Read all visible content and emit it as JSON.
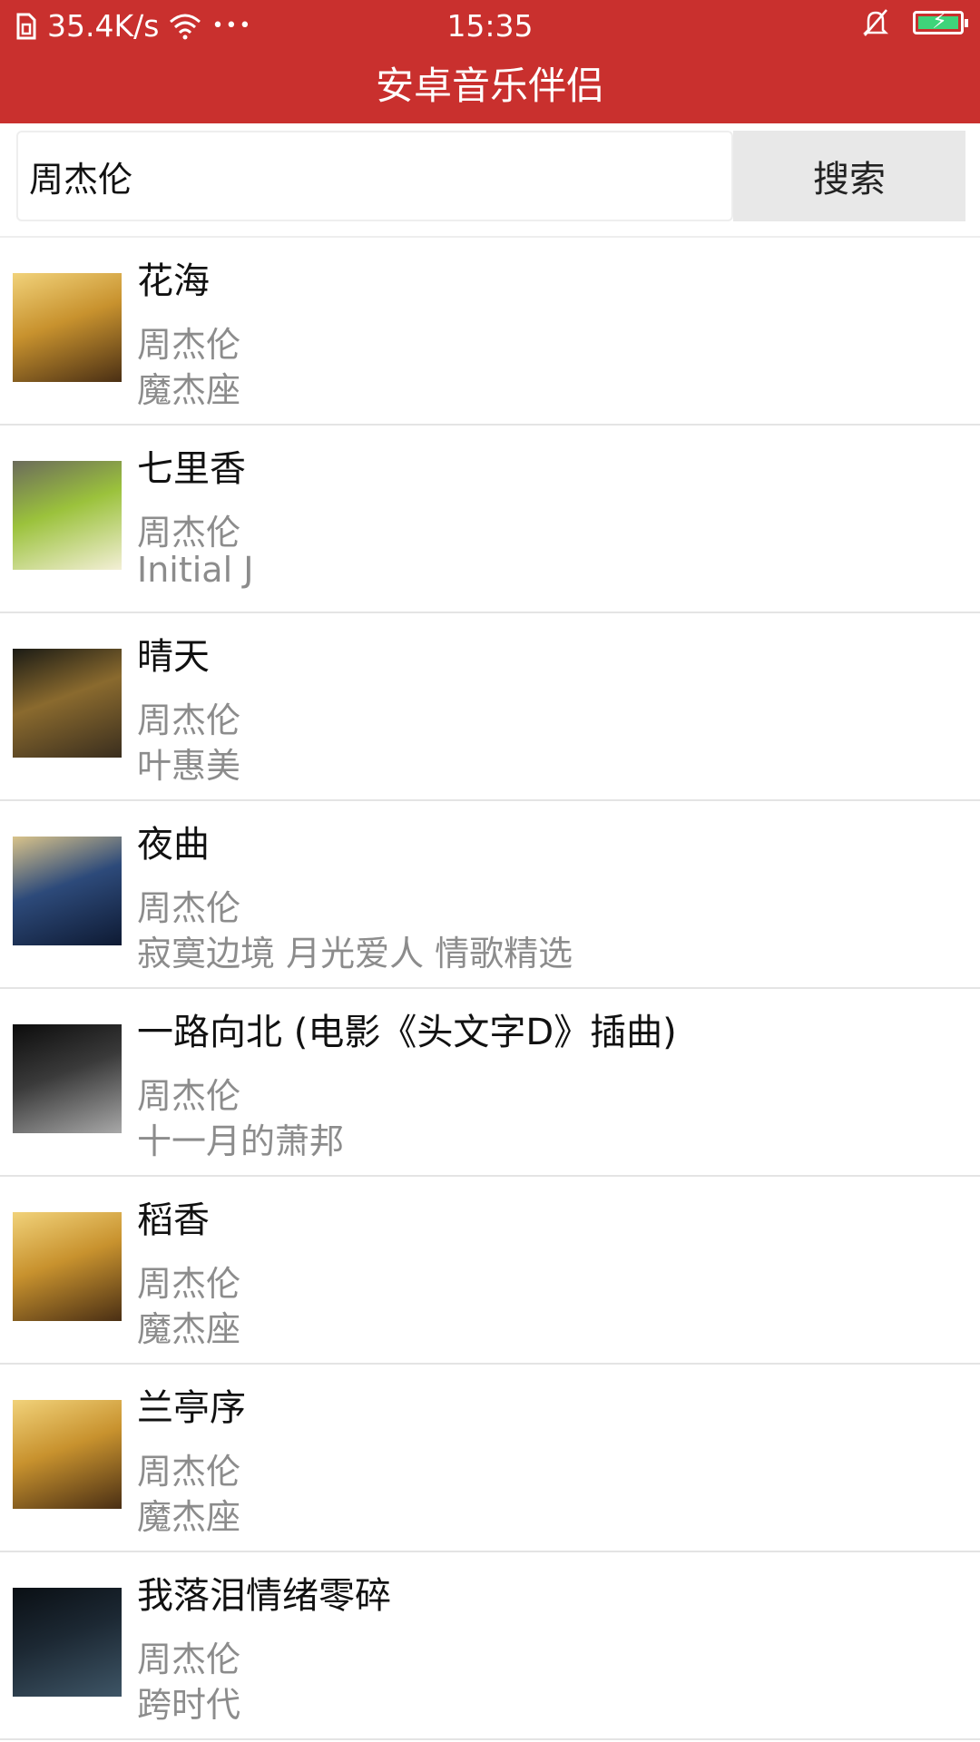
{
  "status_bar": {
    "net_speed": "35.4K/s",
    "dots": "•••",
    "time": "15:35",
    "icons": [
      "sim-icon",
      "wifi-icon",
      "bell-muted-icon",
      "battery-charging-icon"
    ]
  },
  "app": {
    "title": "安卓音乐伴侣",
    "accent": "#c9302e"
  },
  "search": {
    "value": "周杰伦",
    "button_label": "搜索"
  },
  "songs": [
    {
      "title": "花海",
      "artist": "周杰伦",
      "album": "魔杰座",
      "cover": [
        "#4a2f14",
        "#c8922e",
        "#f1d27a"
      ]
    },
    {
      "title": "七里香",
      "artist": "周杰伦",
      "album": "Initial J",
      "cover": [
        "#f3efd6",
        "#9bc23c",
        "#6b6b5b"
      ]
    },
    {
      "title": "晴天",
      "artist": "周杰伦",
      "album": "叶惠美",
      "cover": [
        "#3a2e1e",
        "#8a6a2e",
        "#1b1b15"
      ]
    },
    {
      "title": "夜曲",
      "artist": "周杰伦",
      "album": "寂寞边境 月光爱人 情歌精选",
      "cover": [
        "#0e1a33",
        "#2d4a7a",
        "#d9c38a"
      ]
    },
    {
      "title": "一路向北 (电影《头文字D》插曲)",
      "artist": "周杰伦",
      "album": "十一月的萧邦",
      "cover": [
        "#a8a8a8",
        "#3a3a3a",
        "#0c0c0c"
      ]
    },
    {
      "title": "稻香",
      "artist": "周杰伦",
      "album": "魔杰座",
      "cover": [
        "#4a2f14",
        "#c8922e",
        "#f1d27a"
      ]
    },
    {
      "title": "兰亭序",
      "artist": "周杰伦",
      "album": "魔杰座",
      "cover": [
        "#4a2f14",
        "#c8922e",
        "#f1d27a"
      ]
    },
    {
      "title": "我落泪情绪零碎",
      "artist": "周杰伦",
      "album": "跨时代",
      "cover": [
        "#3e5566",
        "#1c2833",
        "#0a0f14"
      ]
    }
  ]
}
